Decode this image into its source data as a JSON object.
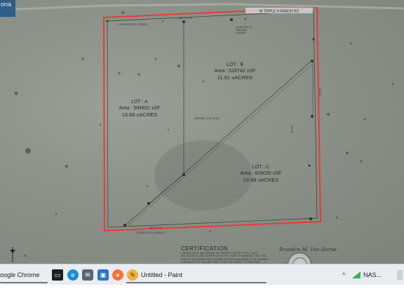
{
  "corner_label": "ona",
  "map": {
    "road_label": "W TRIPLE H RANCH RD",
    "lots": [
      {
        "name": "LOT : B",
        "area": "Area : 518742 ±SF",
        "acres": "11.91 ±ACRES"
      },
      {
        "name": "LOT : A",
        "area": "Area : 594932 ±SF",
        "acres": "13.66 ±ACRES"
      },
      {
        "name": "LOT : C",
        "area": "Area : 609035 ±SF",
        "acres": "13.98 ±ACRES"
      }
    ],
    "side_notes": {
      "top_bearing": "N89°26'10\"E",
      "top_record": "(R) N89°26'10\"E (1335.81)",
      "bottom_bearing": "N89°34'17\"E",
      "bottom_record": "(R) N89°34'17\"E (1336.91)",
      "corner_note_1": "ACCEPTED AS",
      "corner_note_2": "ORIGINAL",
      "corner_note_3": "CORNER",
      "original_note": "ORIGINAL 3 1/4\" PLUG",
      "distance_1": "1306.38",
      "distance_2": "1312.39"
    }
  },
  "certification": {
    "title": "CERTIFICATION",
    "text": "I, BRANDON M. VAN HORNE, DO HEREBY CERTIFY THAT I AM A REGISTERED LAND SURVEYOR IN THE STATE OF ARIZONA, THAT THE SURVEY DESCRIBED AND SHOWN HEREON WAS MADE BY ME DURING THE MONTH OF JANUARY 2023, THAT THE SURVEY IS TRUE AND COMPLETE AS SHOWN, THAT THE MONUMENTS SHOWN EXIST OR WILL BE SET AS SHOWN, THAT THEIR POSITIONS ARE CORRECTLY SHOWN, AND THAT SAID MONUMENTS ARE SUFFICIENT TO ENABLE THE SURVEY TO BE RETRACED.",
    "signature": "Brandon M. Van Horne"
  },
  "taskbar": {
    "items": [
      {
        "label": "oogle Chrome",
        "icon": "chrome-icon",
        "color": "#4285f4"
      },
      {
        "label": "",
        "icon": "task-view-icon",
        "color": "#222222"
      },
      {
        "label": "",
        "icon": "edge-icon",
        "color": "#1a8fd1"
      },
      {
        "label": "",
        "icon": "mail-icon",
        "color": "#5a6572"
      },
      {
        "label": "",
        "icon": "photos-icon",
        "color": "#2b74c9"
      },
      {
        "label": "",
        "icon": "firefox-icon",
        "color": "#ff7139"
      },
      {
        "label": "Untitled - Paint",
        "icon": "paint-icon",
        "color": "#f2b134"
      }
    ],
    "tray_label": "NAS..."
  },
  "colors": {
    "boundary_red": "#e8393d",
    "plat_line": "#3a3a3a",
    "taskbar_bg": "#e9edf2"
  }
}
